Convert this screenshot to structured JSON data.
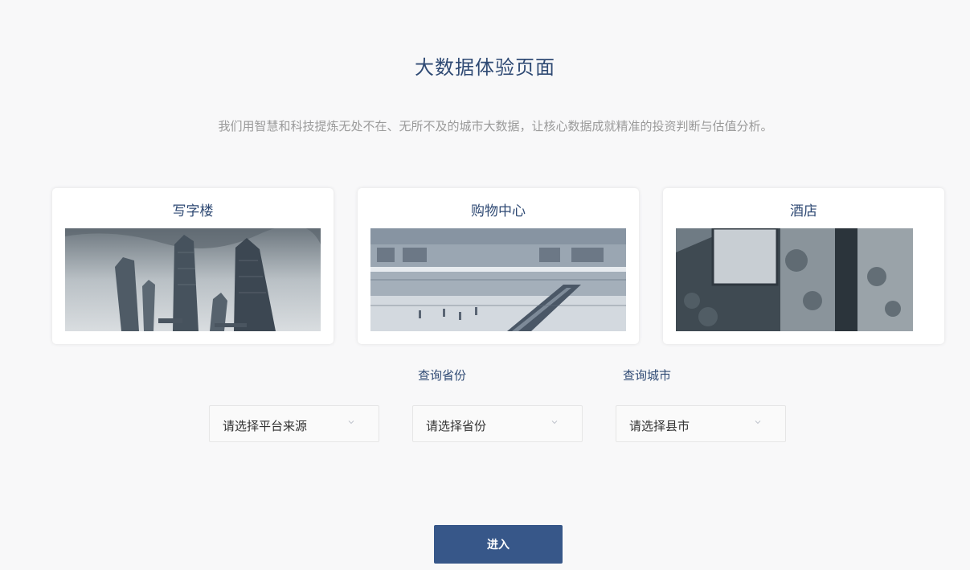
{
  "page": {
    "title": "大数据体验页面",
    "subtitle": "我们用智慧和科技提炼无处不在、无所不及的城市大数据，让核心数据成就精准的投资判断与估值分析。"
  },
  "cards": [
    {
      "title": "写字楼"
    },
    {
      "title": "购物中心"
    },
    {
      "title": "酒店"
    }
  ],
  "filters": {
    "province_label": "查询省份",
    "city_label": "查询城市",
    "platform_select": "请选择平台来源",
    "province_select": "请选择省份",
    "city_select": "请选择县市"
  },
  "actions": {
    "enter": "进入"
  },
  "colors": {
    "accent": "#375789",
    "title": "#2f4a74",
    "muted": "#9a9a9a"
  },
  "icons": {
    "select_chevron": "chevron-down-icon"
  }
}
